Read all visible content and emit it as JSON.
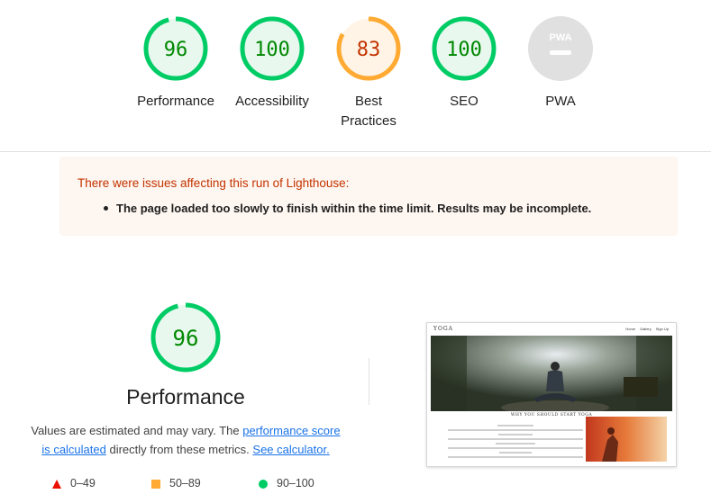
{
  "gauges": [
    {
      "score": "96",
      "label": "Performance",
      "status": "pass"
    },
    {
      "score": "100",
      "label": "Accessibility",
      "status": "pass"
    },
    {
      "score": "83",
      "label_line1": "Best",
      "label_line2": "Practices",
      "status": "average"
    },
    {
      "score": "100",
      "label": "SEO",
      "status": "pass"
    },
    {
      "score": "PWA",
      "label": "PWA",
      "status": "na"
    }
  ],
  "warning": {
    "title": "There were issues affecting this run of Lighthouse:",
    "items": [
      "The page loaded too slowly to finish within the time limit. Results may be incomplete."
    ]
  },
  "performance": {
    "score": "96",
    "title": "Performance",
    "desc_prefix": "Values are estimated and may vary. The ",
    "link_score": "performance score is calculated",
    "desc_middle": " directly from these metrics. ",
    "link_calc": "See calculator."
  },
  "legend": [
    {
      "range": "0–49",
      "icon": "triangle-icon"
    },
    {
      "range": "50–89",
      "icon": "square-icon"
    },
    {
      "range": "90–100",
      "icon": "circle-icon"
    }
  ],
  "thumbnail": {
    "logo": "YOGA",
    "nav": [
      "Home",
      "Gallery",
      "Sign Up"
    ],
    "section_title": "WHY YOU SHOULD START YOGA"
  },
  "colors": {
    "pass": "#00cc66",
    "pass_text": "#008800",
    "pass_bg": "#e8f8ee",
    "average": "#ffaa33",
    "average_text": "#c33300",
    "average_bg": "#fff4e6",
    "fail": "#eb0f00",
    "na": "#e0e0e0",
    "link": "#1a73e8"
  }
}
